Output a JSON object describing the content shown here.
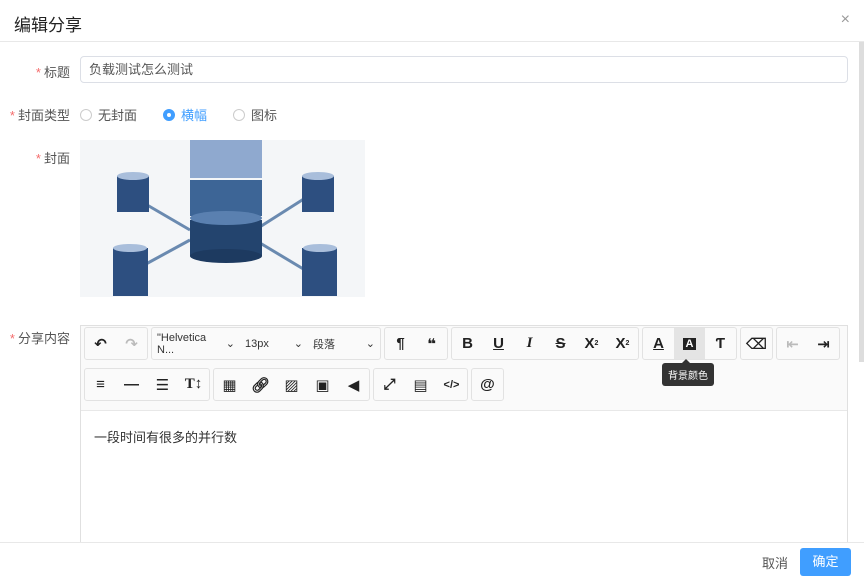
{
  "dialog": {
    "title": "编辑分享",
    "close_icon": "×"
  },
  "form": {
    "title": {
      "label": "标题",
      "value": "负载测试怎么测试"
    },
    "cover_type": {
      "label": "封面类型",
      "options": [
        "无封面",
        "横幅",
        "图标"
      ],
      "selected": "横幅"
    },
    "cover": {
      "label": "封面"
    },
    "content": {
      "label": "分享内容",
      "text": "一段时间有很多的并行数"
    }
  },
  "toolbar": {
    "font_family": "\"Helvetica N...",
    "font_size": "13px",
    "block": "段落",
    "tooltip": "背景颜色"
  },
  "footer": {
    "cancel": "取消",
    "confirm": "确定"
  }
}
